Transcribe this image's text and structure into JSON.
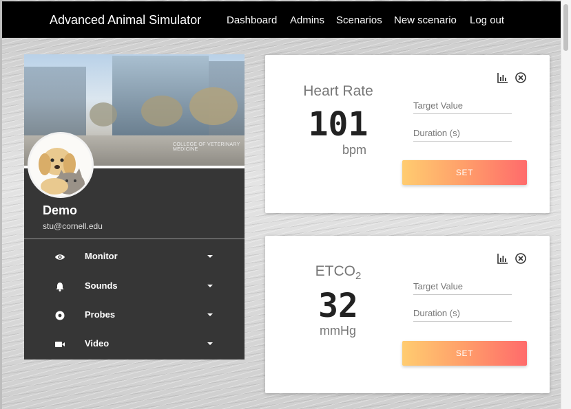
{
  "app": {
    "title": "Advanced Animal Simulator"
  },
  "nav": {
    "links": [
      "Dashboard",
      "Admins",
      "Scenarios",
      "New scenario",
      "Log out"
    ]
  },
  "profile": {
    "image_caption": "COLLEGE OF VETERINARY MEDICINE",
    "name": "Demo",
    "email": "stu@cornell.edu",
    "menu": [
      {
        "label": "Monitor",
        "icon": "eye-icon"
      },
      {
        "label": "Sounds",
        "icon": "bell-icon"
      },
      {
        "label": "Probes",
        "icon": "probe-icon"
      },
      {
        "label": "Video",
        "icon": "video-camera-icon"
      }
    ]
  },
  "cards": [
    {
      "title": "Heart Rate",
      "value": "101",
      "unit": "bpm",
      "target_placeholder": "Target Value",
      "duration_placeholder": "Duration (s)",
      "button": "SET"
    },
    {
      "title": "ETCO",
      "title_sub": "2",
      "value": "32",
      "unit": "mmHg",
      "target_placeholder": "Target Value",
      "duration_placeholder": "Duration (s)",
      "button": "SET"
    }
  ],
  "colors": {
    "navbar": "#000000",
    "sidebar": "#363636",
    "button_start": "#ffcc70",
    "button_end": "#ff6b6b"
  }
}
